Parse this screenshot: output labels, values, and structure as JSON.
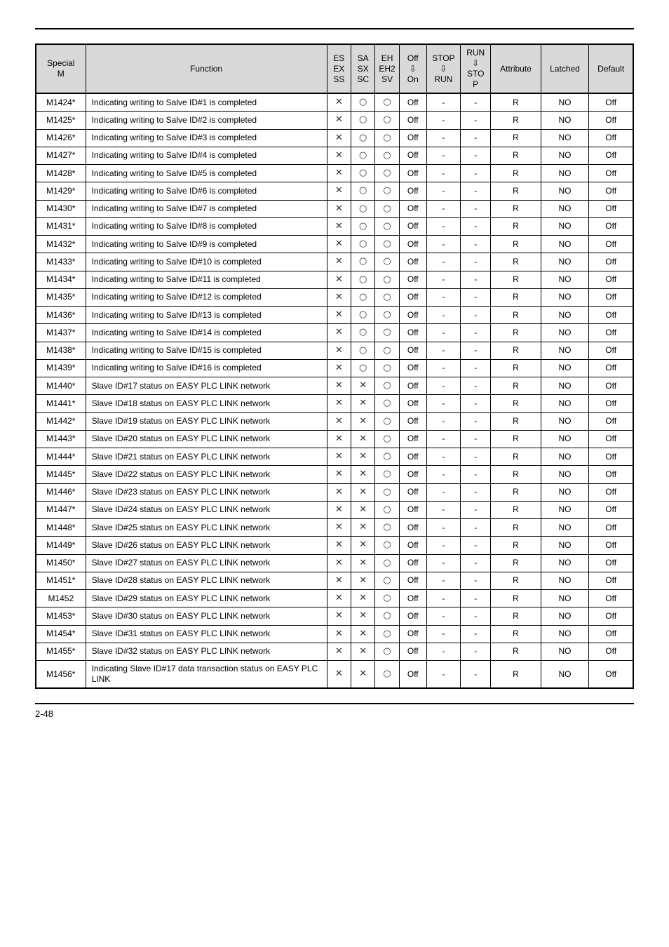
{
  "headers": {
    "special_m": "Special\nM",
    "function": "Function",
    "es": "ES\nEX\nSS",
    "sa": "SA\nSX\nSC",
    "eh": "EH\nEH2\nSV",
    "off": "Off\n⇩\nOn",
    "stop": "STOP\n⇩\nRUN",
    "run": "RUN\n⇩\nSTO\nP",
    "attribute": "Attribute",
    "latched": "Latched",
    "default": "Default"
  },
  "marks": {
    "x": "✕",
    "o": "○",
    "dash": "-"
  },
  "rows": [
    {
      "m": "M1424*",
      "fn": "Indicating writing to Salve ID#1 is completed",
      "es": "x",
      "sa": "o",
      "eh": "o",
      "off": "Off",
      "stop": "-",
      "run": "-",
      "attr": "R",
      "lat": "NO",
      "def": "Off"
    },
    {
      "m": "M1425*",
      "fn": "Indicating writing to Salve ID#2 is completed",
      "es": "x",
      "sa": "o",
      "eh": "o",
      "off": "Off",
      "stop": "-",
      "run": "-",
      "attr": "R",
      "lat": "NO",
      "def": "Off"
    },
    {
      "m": "M1426*",
      "fn": "Indicating writing to Salve ID#3 is completed",
      "es": "x",
      "sa": "o",
      "eh": "o",
      "off": "Off",
      "stop": "-",
      "run": "-",
      "attr": "R",
      "lat": "NO",
      "def": "Off"
    },
    {
      "m": "M1427*",
      "fn": "Indicating writing to Salve ID#4 is completed",
      "es": "x",
      "sa": "o",
      "eh": "o",
      "off": "Off",
      "stop": "-",
      "run": "-",
      "attr": "R",
      "lat": "NO",
      "def": "Off"
    },
    {
      "m": "M1428*",
      "fn": "Indicating writing to Salve ID#5 is completed",
      "es": "x",
      "sa": "o",
      "eh": "o",
      "off": "Off",
      "stop": "-",
      "run": "-",
      "attr": "R",
      "lat": "NO",
      "def": "Off"
    },
    {
      "m": "M1429*",
      "fn": "Indicating writing to Salve ID#6 is completed",
      "es": "x",
      "sa": "o",
      "eh": "o",
      "off": "Off",
      "stop": "-",
      "run": "-",
      "attr": "R",
      "lat": "NO",
      "def": "Off"
    },
    {
      "m": "M1430*",
      "fn": "Indicating writing to Salve ID#7 is completed",
      "es": "x",
      "sa": "o",
      "eh": "o",
      "off": "Off",
      "stop": "-",
      "run": "-",
      "attr": "R",
      "lat": "NO",
      "def": "Off"
    },
    {
      "m": "M1431*",
      "fn": "Indicating writing to Salve ID#8 is completed",
      "es": "x",
      "sa": "o",
      "eh": "o",
      "off": "Off",
      "stop": "-",
      "run": "-",
      "attr": "R",
      "lat": "NO",
      "def": "Off"
    },
    {
      "m": "M1432*",
      "fn": "Indicating writing to Salve ID#9 is completed",
      "es": "x",
      "sa": "o",
      "eh": "o",
      "off": "Off",
      "stop": "-",
      "run": "-",
      "attr": "R",
      "lat": "NO",
      "def": "Off"
    },
    {
      "m": "M1433*",
      "fn": "Indicating writing to Salve ID#10 is completed",
      "es": "x",
      "sa": "o",
      "eh": "o",
      "off": "Off",
      "stop": "-",
      "run": "-",
      "attr": "R",
      "lat": "NO",
      "def": "Off"
    },
    {
      "m": "M1434*",
      "fn": "Indicating writing to Salve ID#11 is completed",
      "es": "x",
      "sa": "o",
      "eh": "o",
      "off": "Off",
      "stop": "-",
      "run": "-",
      "attr": "R",
      "lat": "NO",
      "def": "Off"
    },
    {
      "m": "M1435*",
      "fn": "Indicating writing to Salve ID#12 is completed",
      "es": "x",
      "sa": "o",
      "eh": "o",
      "off": "Off",
      "stop": "-",
      "run": "-",
      "attr": "R",
      "lat": "NO",
      "def": "Off"
    },
    {
      "m": "M1436*",
      "fn": "Indicating writing to Salve ID#13 is completed",
      "es": "x",
      "sa": "o",
      "eh": "o",
      "off": "Off",
      "stop": "-",
      "run": "-",
      "attr": "R",
      "lat": "NO",
      "def": "Off"
    },
    {
      "m": "M1437*",
      "fn": "Indicating writing to Salve ID#14 is completed",
      "es": "x",
      "sa": "o",
      "eh": "o",
      "off": "Off",
      "stop": "-",
      "run": "-",
      "attr": "R",
      "lat": "NO",
      "def": "Off"
    },
    {
      "m": "M1438*",
      "fn": "Indicating writing to Salve ID#15 is completed",
      "es": "x",
      "sa": "o",
      "eh": "o",
      "off": "Off",
      "stop": "-",
      "run": "-",
      "attr": "R",
      "lat": "NO",
      "def": "Off"
    },
    {
      "m": "M1439*",
      "fn": "Indicating writing to Salve ID#16 is completed",
      "es": "x",
      "sa": "o",
      "eh": "o",
      "off": "Off",
      "stop": "-",
      "run": "-",
      "attr": "R",
      "lat": "NO",
      "def": "Off"
    },
    {
      "m": "M1440*",
      "fn": "Slave ID#17 status on EASY PLC LINK network",
      "es": "x",
      "sa": "x",
      "eh": "o",
      "off": "Off",
      "stop": "-",
      "run": "-",
      "attr": "R",
      "lat": "NO",
      "def": "Off"
    },
    {
      "m": "M1441*",
      "fn": "Slave ID#18 status on EASY PLC LINK network",
      "es": "x",
      "sa": "x",
      "eh": "o",
      "off": "Off",
      "stop": "-",
      "run": "-",
      "attr": "R",
      "lat": "NO",
      "def": "Off"
    },
    {
      "m": "M1442*",
      "fn": "Slave ID#19 status on EASY PLC LINK network",
      "es": "x",
      "sa": "x",
      "eh": "o",
      "off": "Off",
      "stop": "-",
      "run": "-",
      "attr": "R",
      "lat": "NO",
      "def": "Off"
    },
    {
      "m": "M1443*",
      "fn": "Slave ID#20 status on EASY PLC LINK network",
      "es": "x",
      "sa": "x",
      "eh": "o",
      "off": "Off",
      "stop": "-",
      "run": "-",
      "attr": "R",
      "lat": "NO",
      "def": "Off"
    },
    {
      "m": "M1444*",
      "fn": "Slave ID#21 status on EASY PLC LINK network",
      "es": "x",
      "sa": "x",
      "eh": "o",
      "off": "Off",
      "stop": "-",
      "run": "-",
      "attr": "R",
      "lat": "NO",
      "def": "Off"
    },
    {
      "m": "M1445*",
      "fn": "Slave ID#22 status on EASY PLC LINK network",
      "es": "x",
      "sa": "x",
      "eh": "o",
      "off": "Off",
      "stop": "-",
      "run": "-",
      "attr": "R",
      "lat": "NO",
      "def": "Off"
    },
    {
      "m": "M1446*",
      "fn": "Slave ID#23 status on EASY PLC LINK network",
      "es": "x",
      "sa": "x",
      "eh": "o",
      "off": "Off",
      "stop": "-",
      "run": "-",
      "attr": "R",
      "lat": "NO",
      "def": "Off"
    },
    {
      "m": "M1447*",
      "fn": "Slave ID#24 status on EASY PLC LINK network",
      "es": "x",
      "sa": "x",
      "eh": "o",
      "off": "Off",
      "stop": "-",
      "run": "-",
      "attr": "R",
      "lat": "NO",
      "def": "Off"
    },
    {
      "m": "M1448*",
      "fn": "Slave ID#25 status on EASY PLC LINK network",
      "es": "x",
      "sa": "x",
      "eh": "o",
      "off": "Off",
      "stop": "-",
      "run": "-",
      "attr": "R",
      "lat": "NO",
      "def": "Off"
    },
    {
      "m": "M1449*",
      "fn": "Slave ID#26 status on EASY PLC LINK network",
      "es": "x",
      "sa": "x",
      "eh": "o",
      "off": "Off",
      "stop": "-",
      "run": "-",
      "attr": "R",
      "lat": "NO",
      "def": "Off"
    },
    {
      "m": "M1450*",
      "fn": "Slave ID#27 status on EASY PLC LINK network",
      "es": "x",
      "sa": "x",
      "eh": "o",
      "off": "Off",
      "stop": "-",
      "run": "-",
      "attr": "R",
      "lat": "NO",
      "def": "Off"
    },
    {
      "m": "M1451*",
      "fn": "Slave ID#28 status on EASY PLC LINK network",
      "es": "x",
      "sa": "x",
      "eh": "o",
      "off": "Off",
      "stop": "-",
      "run": "-",
      "attr": "R",
      "lat": "NO",
      "def": "Off"
    },
    {
      "m": "M1452",
      "fn": "Slave ID#29 status on EASY PLC LINK network",
      "es": "x",
      "sa": "x",
      "eh": "o",
      "off": "Off",
      "stop": "-",
      "run": "-",
      "attr": "R",
      "lat": "NO",
      "def": "Off"
    },
    {
      "m": "M1453*",
      "fn": "Slave ID#30 status on EASY PLC LINK network",
      "es": "x",
      "sa": "x",
      "eh": "o",
      "off": "Off",
      "stop": "-",
      "run": "-",
      "attr": "R",
      "lat": "NO",
      "def": "Off"
    },
    {
      "m": "M1454*",
      "fn": "Slave ID#31 status on EASY PLC LINK network",
      "es": "x",
      "sa": "x",
      "eh": "o",
      "off": "Off",
      "stop": "-",
      "run": "-",
      "attr": "R",
      "lat": "NO",
      "def": "Off"
    },
    {
      "m": "M1455*",
      "fn": "Slave ID#32 status on EASY PLC LINK network",
      "es": "x",
      "sa": "x",
      "eh": "o",
      "off": "Off",
      "stop": "-",
      "run": "-",
      "attr": "R",
      "lat": "NO",
      "def": "Off"
    },
    {
      "m": "M1456*",
      "fn": "Indicating Slave ID#17 data transaction status on EASY PLC LINK",
      "es": "x",
      "sa": "x",
      "eh": "o",
      "off": "Off",
      "stop": "-",
      "run": "-",
      "attr": "R",
      "lat": "NO",
      "def": "Off"
    }
  ],
  "footer": {
    "page": "2-48"
  }
}
